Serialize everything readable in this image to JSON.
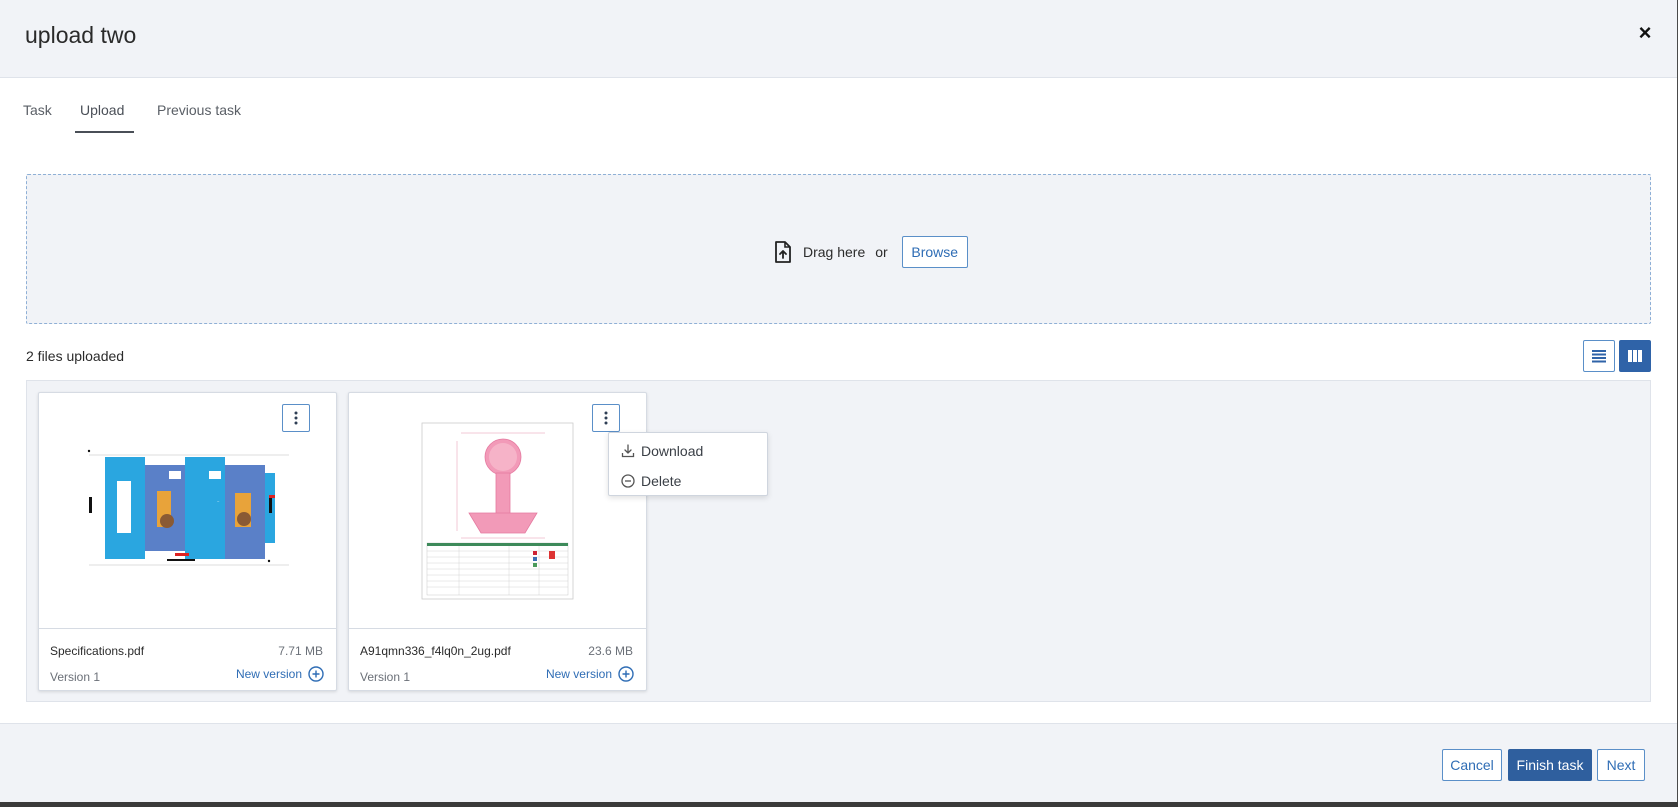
{
  "dialog": {
    "title": "upload two",
    "close_label": "×"
  },
  "tabs": [
    {
      "label": "Task",
      "active": false
    },
    {
      "label": "Upload",
      "active": true
    },
    {
      "label": "Previous task",
      "active": false
    }
  ],
  "dropzone": {
    "drag_text": "Drag here",
    "or_text": "or",
    "browse_label": "Browse"
  },
  "files_count_text": "2 files uploaded",
  "view_toggle": {
    "active": "grid"
  },
  "files": [
    {
      "name": "Specifications.pdf",
      "size": "7.71 MB",
      "version": "Version 1",
      "new_version_label": "New version"
    },
    {
      "name": "A91qmn336_f4lq0n_2ug.pdf",
      "size": "23.6 MB",
      "version": "Version 1",
      "new_version_label": "New version"
    }
  ],
  "context_menu": {
    "items": [
      {
        "label": "Download",
        "icon": "download-icon"
      },
      {
        "label": "Delete",
        "icon": "minus-circle-icon"
      }
    ]
  },
  "footer": {
    "cancel_label": "Cancel",
    "finish_label": "Finish task",
    "next_label": "Next"
  },
  "colors": {
    "accent": "#2f63a8",
    "link": "#2f6db5",
    "panel_bg": "#f1f3f7"
  }
}
